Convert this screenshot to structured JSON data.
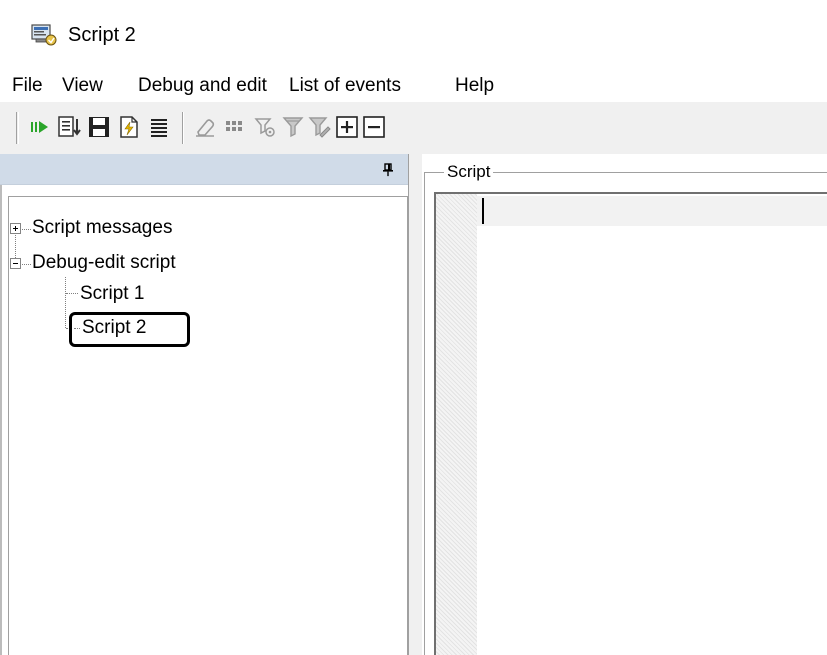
{
  "window": {
    "title": "Script 2",
    "icon": "script-app-icon"
  },
  "menu": {
    "items": [
      "File",
      "View",
      "Debug and edit",
      "List of events",
      "Help"
    ]
  },
  "toolbar": {
    "buttons": [
      {
        "icon": "run-icon"
      },
      {
        "icon": "step-list-icon"
      },
      {
        "icon": "save-icon"
      },
      {
        "icon": "new-script-icon"
      },
      {
        "icon": "align-lines-icon"
      },
      {
        "icon": "eraser-icon"
      },
      {
        "icon": "grid-icon"
      },
      {
        "icon": "filter-gear-icon"
      },
      {
        "icon": "filter-icon"
      },
      {
        "icon": "filter-edit-icon"
      },
      {
        "icon": "expand-plus-icon"
      },
      {
        "icon": "collapse-minus-icon"
      }
    ]
  },
  "tree": {
    "items": [
      {
        "label": "Script messages",
        "expander": "plus"
      },
      {
        "label": "Debug-edit script",
        "expander": "minus"
      },
      {
        "label": "Script 1"
      },
      {
        "label": "Script 2",
        "selected": true
      }
    ]
  },
  "script_pane": {
    "legend": "Script"
  },
  "colors": {
    "panel_header": "#d0dbe8",
    "toolbar_bg": "#f0f0f0",
    "run_green": "#2aa52a"
  }
}
